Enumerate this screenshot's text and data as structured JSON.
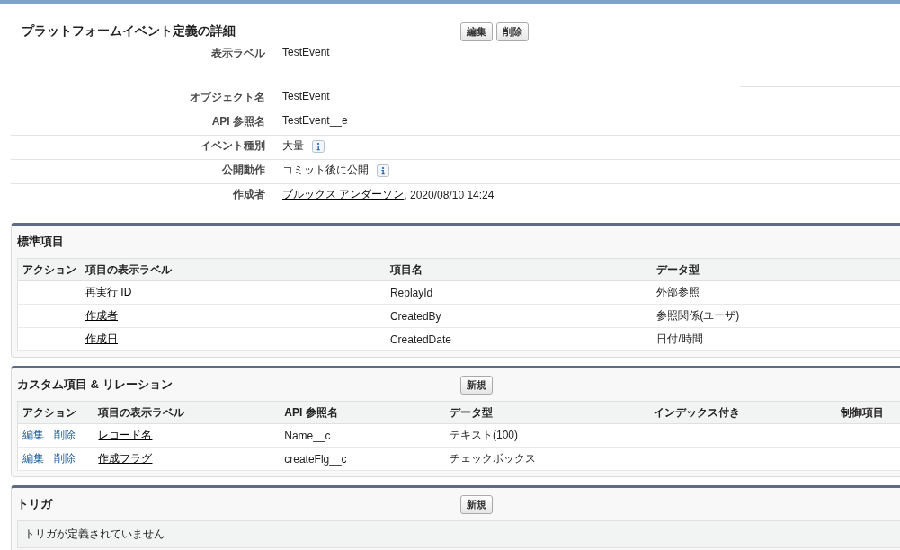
{
  "detail": {
    "title": "プラットフォームイベント定義の詳細",
    "buttons": [
      "編集",
      "削除"
    ],
    "rows": [
      {
        "kind": "text",
        "label": "表示ラベル",
        "value": "TestEvent"
      },
      {
        "kind": "spacer"
      },
      {
        "kind": "text",
        "label": "オブジェクト名",
        "value": "TestEvent"
      },
      {
        "kind": "text",
        "label": "API 参照名",
        "value": "TestEvent__e"
      },
      {
        "kind": "info",
        "label": "イベント種別",
        "value": "大量"
      },
      {
        "kind": "info",
        "label": "公開動作",
        "value": "コミット後に公開"
      },
      {
        "kind": "user",
        "label": "作成者",
        "link": "ブルックス アンダーソン",
        "value": ", 2020/08/10 14:24"
      }
    ]
  },
  "sections": [
    {
      "title": "標準項目",
      "columns": [
        "アクション",
        "項目の表示ラベル",
        "項目名",
        "データ型"
      ],
      "rows": [
        {
          "cells": [
            "",
            "再実行 ID",
            "ReplayId",
            "外部参照"
          ]
        },
        {
          "cells": [
            "",
            "作成者",
            "CreatedBy",
            "参照関係(ユーザ)"
          ]
        },
        {
          "cells": [
            "",
            "作成日",
            "CreatedDate",
            "日付/時間"
          ]
        }
      ]
    },
    {
      "title": "カスタム項目 & リレーション",
      "button": "新規",
      "columns": [
        "アクション",
        "項目の表示ラベル",
        "API 参照名",
        "データ型",
        "インデックス付き",
        "制御項目"
      ],
      "rows": [
        {
          "cells": [
            [
              "編集",
              "削除"
            ],
            "レコード名",
            "Name__c",
            "テキスト(100)",
            "",
            ""
          ]
        },
        {
          "cells": [
            [
              "編集",
              "削除"
            ],
            "作成フラグ",
            "createFlg__c",
            "チェックボックス",
            "",
            ""
          ]
        }
      ]
    },
    {
      "title": "トリガ",
      "button": "新規",
      "empty": "トリガが定義されていません"
    }
  ]
}
